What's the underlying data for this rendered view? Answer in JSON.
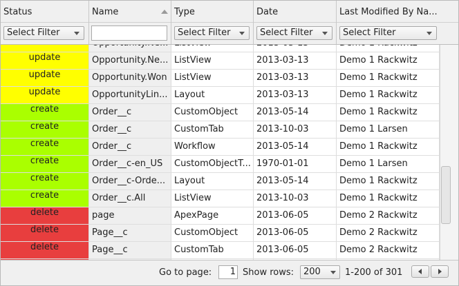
{
  "columns": [
    {
      "key": "status",
      "label": "Status"
    },
    {
      "key": "name",
      "label": "Name"
    },
    {
      "key": "type",
      "label": "Type"
    },
    {
      "key": "date",
      "label": "Date"
    },
    {
      "key": "modified",
      "label": "Last Modified By Na..."
    }
  ],
  "filters": {
    "status": "Select Filter",
    "name_value": "",
    "type": "Select Filter",
    "date": "Select Filter",
    "modified": "Select Filter"
  },
  "status_colors": {
    "update": "#ffff00",
    "create": "#aaff00",
    "delete": "#e83e3e"
  },
  "rows": [
    {
      "status": "update",
      "name": "Opportunity.Ne...",
      "type": "ListView",
      "date": "2013-03-13",
      "modified": "Demo 1 Rackwitz"
    },
    {
      "status": "update",
      "name": "Opportunity.Ne...",
      "type": "ListView",
      "date": "2013-03-13",
      "modified": "Demo 1 Rackwitz"
    },
    {
      "status": "update",
      "name": "Opportunity.Won",
      "type": "ListView",
      "date": "2013-03-13",
      "modified": "Demo 1 Rackwitz"
    },
    {
      "status": "update",
      "name": "OpportunityLin...",
      "type": "Layout",
      "date": "2013-03-13",
      "modified": "Demo 1 Rackwitz"
    },
    {
      "status": "create",
      "name": "Order__c",
      "type": "CustomObject",
      "date": "2013-05-14",
      "modified": "Demo 1 Rackwitz"
    },
    {
      "status": "create",
      "name": "Order__c",
      "type": "CustomTab",
      "date": "2013-10-03",
      "modified": "Demo 1 Larsen"
    },
    {
      "status": "create",
      "name": "Order__c",
      "type": "Workflow",
      "date": "2013-05-14",
      "modified": "Demo 1 Rackwitz"
    },
    {
      "status": "create",
      "name": "Order__c-en_US",
      "type": "CustomObjectT...",
      "date": "1970-01-01",
      "modified": "Demo 1 Larsen"
    },
    {
      "status": "create",
      "name": "Order__c-Orde...",
      "type": "Layout",
      "date": "2013-05-14",
      "modified": "Demo 1 Rackwitz"
    },
    {
      "status": "create",
      "name": "Order__c.All",
      "type": "ListView",
      "date": "2013-10-03",
      "modified": "Demo 1 Rackwitz"
    },
    {
      "status": "delete",
      "name": "page",
      "type": "ApexPage",
      "date": "2013-06-05",
      "modified": "Demo 2 Rackwitz"
    },
    {
      "status": "delete",
      "name": "Page__c",
      "type": "CustomObject",
      "date": "2013-06-05",
      "modified": "Demo 2 Rackwitz"
    },
    {
      "status": "delete",
      "name": "Page__c",
      "type": "CustomTab",
      "date": "2013-06-05",
      "modified": "Demo 2 Rackwitz"
    },
    {
      "status": "delete",
      "name": "",
      "type": "",
      "date": "",
      "modified": ""
    }
  ],
  "pager": {
    "goto_label": "Go to page:",
    "page": "1",
    "show_rows_label": "Show rows:",
    "rows_per_page": "200",
    "range": "1-200 of 301"
  }
}
